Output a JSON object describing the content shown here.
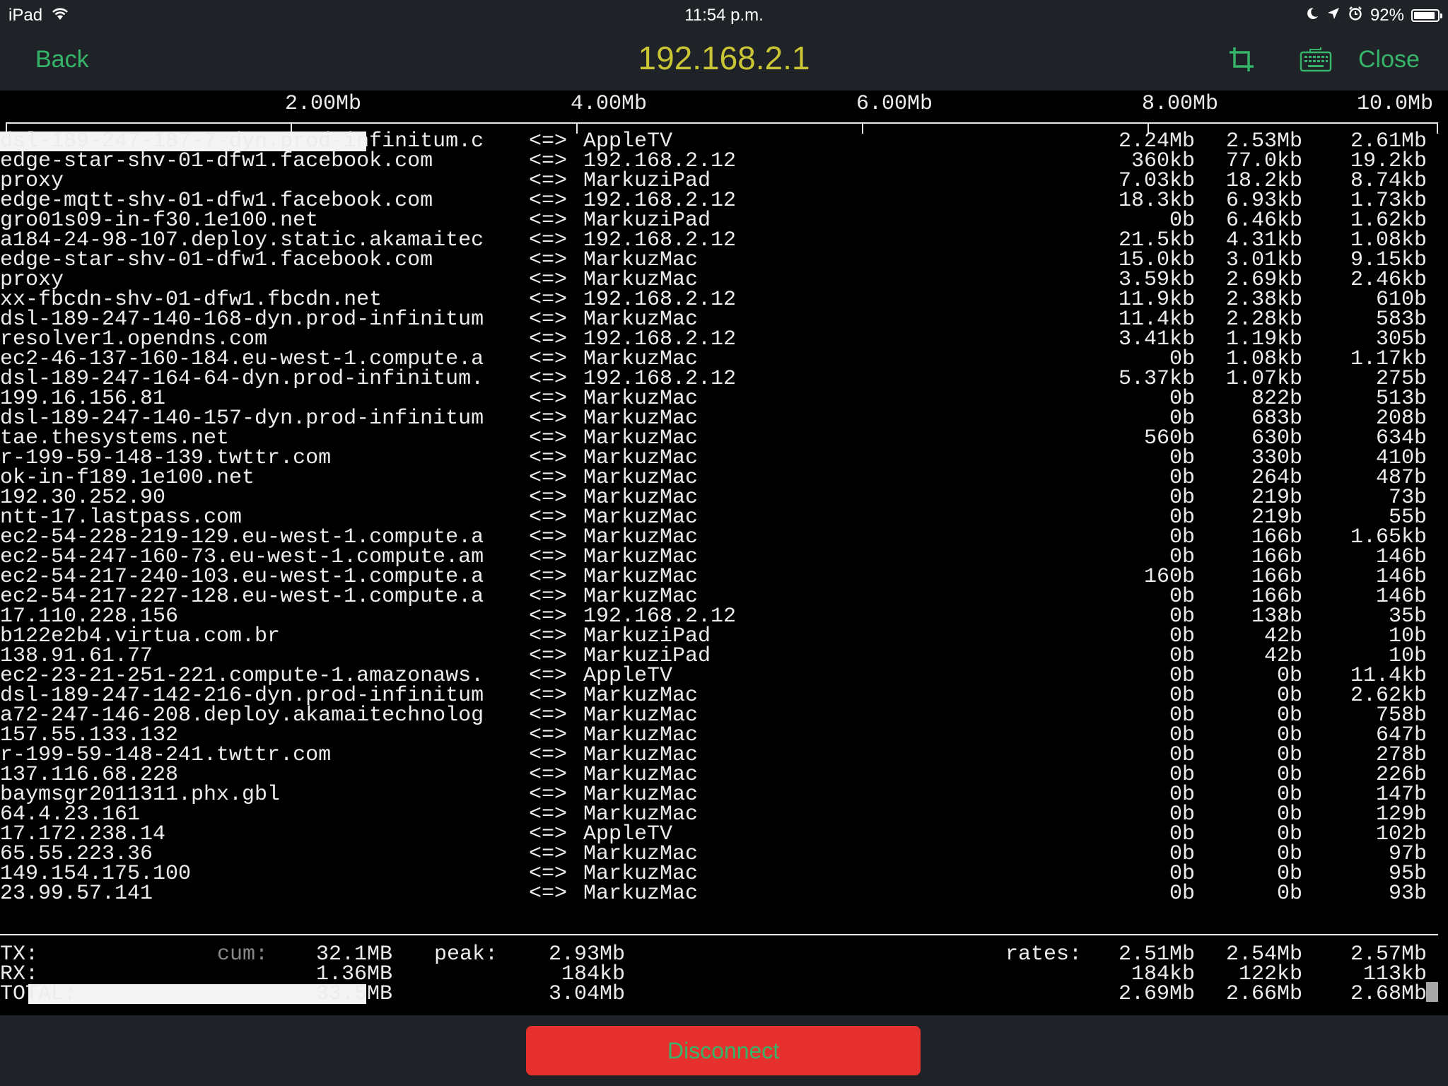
{
  "status_bar": {
    "device": "iPad",
    "time": "11:54 p.m.",
    "battery_percent": "92%",
    "battery_level": 0.92,
    "icons": [
      "wifi-icon",
      "moon-icon",
      "location-arrow-icon",
      "alarm-icon",
      "battery-icon"
    ]
  },
  "nav": {
    "back_label": "Back",
    "title": "192.168.2.1",
    "crop_icon": "crop-icon",
    "keyboard_icon": "keyboard-icon",
    "close_label": "Close"
  },
  "colors": {
    "bar_background": "#1f2327",
    "accent_green": "#36b56a",
    "title_yellow": "#c9c534",
    "disconnect_red": "#e5302e",
    "terminal_text": "#ececec"
  },
  "scale": {
    "labels": [
      "2.00Mb",
      "4.00Mb",
      "6.00Mb",
      "8.00Mb",
      "10.0Mb"
    ]
  },
  "connections": [
    {
      "host": "dsl-189-247-187-7-dyn.prod-infinitum.c",
      "dir": "<=>",
      "peer": "AppleTV",
      "r1": "2.24Mb",
      "r2": "2.53Mb",
      "r3": "2.61Mb"
    },
    {
      "host": "edge-star-shv-01-dfw1.facebook.com",
      "dir": "<=>",
      "peer": "192.168.2.12",
      "r1": "360kb",
      "r2": "77.0kb",
      "r3": "19.2kb"
    },
    {
      "host": "proxy",
      "dir": "<=>",
      "peer": "MarkuziPad",
      "r1": "7.03kb",
      "r2": "18.2kb",
      "r3": "8.74kb"
    },
    {
      "host": "edge-mqtt-shv-01-dfw1.facebook.com",
      "dir": "<=>",
      "peer": "192.168.2.12",
      "r1": "18.3kb",
      "r2": "6.93kb",
      "r3": "1.73kb"
    },
    {
      "host": "gro01s09-in-f30.1e100.net",
      "dir": "<=>",
      "peer": "MarkuziPad",
      "r1": "0b",
      "r2": "6.46kb",
      "r3": "1.62kb"
    },
    {
      "host": "a184-24-98-107.deploy.static.akamaitec",
      "dir": "<=>",
      "peer": "192.168.2.12",
      "r1": "21.5kb",
      "r2": "4.31kb",
      "r3": "1.08kb"
    },
    {
      "host": "edge-star-shv-01-dfw1.facebook.com",
      "dir": "<=>",
      "peer": "MarkuzMac",
      "r1": "15.0kb",
      "r2": "3.01kb",
      "r3": "9.15kb"
    },
    {
      "host": "proxy",
      "dir": "<=>",
      "peer": "MarkuzMac",
      "r1": "3.59kb",
      "r2": "2.69kb",
      "r3": "2.46kb"
    },
    {
      "host": "xx-fbcdn-shv-01-dfw1.fbcdn.net",
      "dir": "<=>",
      "peer": "192.168.2.12",
      "r1": "11.9kb",
      "r2": "2.38kb",
      "r3": "610b"
    },
    {
      "host": "dsl-189-247-140-168-dyn.prod-infinitum",
      "dir": "<=>",
      "peer": "MarkuzMac",
      "r1": "11.4kb",
      "r2": "2.28kb",
      "r3": "583b"
    },
    {
      "host": "resolver1.opendns.com",
      "dir": "<=>",
      "peer": "192.168.2.12",
      "r1": "3.41kb",
      "r2": "1.19kb",
      "r3": "305b"
    },
    {
      "host": "ec2-46-137-160-184.eu-west-1.compute.a",
      "dir": "<=>",
      "peer": "MarkuzMac",
      "r1": "0b",
      "r2": "1.08kb",
      "r3": "1.17kb"
    },
    {
      "host": "dsl-189-247-164-64-dyn.prod-infinitum.",
      "dir": "<=>",
      "peer": "192.168.2.12",
      "r1": "5.37kb",
      "r2": "1.07kb",
      "r3": "275b"
    },
    {
      "host": "199.16.156.81",
      "dir": "<=>",
      "peer": "MarkuzMac",
      "r1": "0b",
      "r2": "822b",
      "r3": "513b"
    },
    {
      "host": "dsl-189-247-140-157-dyn.prod-infinitum",
      "dir": "<=>",
      "peer": "MarkuzMac",
      "r1": "0b",
      "r2": "683b",
      "r3": "208b"
    },
    {
      "host": "tae.thesystems.net",
      "dir": "<=>",
      "peer": "MarkuzMac",
      "r1": "560b",
      "r2": "630b",
      "r3": "634b"
    },
    {
      "host": "r-199-59-148-139.twttr.com",
      "dir": "<=>",
      "peer": "MarkuzMac",
      "r1": "0b",
      "r2": "330b",
      "r3": "410b"
    },
    {
      "host": "ok-in-f189.1e100.net",
      "dir": "<=>",
      "peer": "MarkuzMac",
      "r1": "0b",
      "r2": "264b",
      "r3": "487b"
    },
    {
      "host": "192.30.252.90",
      "dir": "<=>",
      "peer": "MarkuzMac",
      "r1": "0b",
      "r2": "219b",
      "r3": "73b"
    },
    {
      "host": "ntt-17.lastpass.com",
      "dir": "<=>",
      "peer": "MarkuzMac",
      "r1": "0b",
      "r2": "219b",
      "r3": "55b"
    },
    {
      "host": "ec2-54-228-219-129.eu-west-1.compute.a",
      "dir": "<=>",
      "peer": "MarkuzMac",
      "r1": "0b",
      "r2": "166b",
      "r3": "1.65kb"
    },
    {
      "host": "ec2-54-247-160-73.eu-west-1.compute.am",
      "dir": "<=>",
      "peer": "MarkuzMac",
      "r1": "0b",
      "r2": "166b",
      "r3": "146b"
    },
    {
      "host": "ec2-54-217-240-103.eu-west-1.compute.a",
      "dir": "<=>",
      "peer": "MarkuzMac",
      "r1": "160b",
      "r2": "166b",
      "r3": "146b"
    },
    {
      "host": "ec2-54-217-227-128.eu-west-1.compute.a",
      "dir": "<=>",
      "peer": "MarkuzMac",
      "r1": "0b",
      "r2": "166b",
      "r3": "146b"
    },
    {
      "host": "17.110.228.156",
      "dir": "<=>",
      "peer": "192.168.2.12",
      "r1": "0b",
      "r2": "138b",
      "r3": "35b"
    },
    {
      "host": "b122e2b4.virtua.com.br",
      "dir": "<=>",
      "peer": "MarkuziPad",
      "r1": "0b",
      "r2": "42b",
      "r3": "10b"
    },
    {
      "host": "138.91.61.77",
      "dir": "<=>",
      "peer": "MarkuziPad",
      "r1": "0b",
      "r2": "42b",
      "r3": "10b"
    },
    {
      "host": "ec2-23-21-251-221.compute-1.amazonaws.",
      "dir": "<=>",
      "peer": "AppleTV",
      "r1": "0b",
      "r2": "0b",
      "r3": "11.4kb"
    },
    {
      "host": "dsl-189-247-142-216-dyn.prod-infinitum",
      "dir": "<=>",
      "peer": "MarkuzMac",
      "r1": "0b",
      "r2": "0b",
      "r3": "2.62kb"
    },
    {
      "host": "a72-247-146-208.deploy.akamaitechnolog",
      "dir": "<=>",
      "peer": "MarkuzMac",
      "r1": "0b",
      "r2": "0b",
      "r3": "758b"
    },
    {
      "host": "157.55.133.132",
      "dir": "<=>",
      "peer": "MarkuzMac",
      "r1": "0b",
      "r2": "0b",
      "r3": "647b"
    },
    {
      "host": "r-199-59-148-241.twttr.com",
      "dir": "<=>",
      "peer": "MarkuzMac",
      "r1": "0b",
      "r2": "0b",
      "r3": "278b"
    },
    {
      "host": "137.116.68.228",
      "dir": "<=>",
      "peer": "MarkuzMac",
      "r1": "0b",
      "r2": "0b",
      "r3": "226b"
    },
    {
      "host": "baymsgr2011311.phx.gbl",
      "dir": "<=>",
      "peer": "MarkuzMac",
      "r1": "0b",
      "r2": "0b",
      "r3": "147b"
    },
    {
      "host": "64.4.23.161",
      "dir": "<=>",
      "peer": "MarkuzMac",
      "r1": "0b",
      "r2": "0b",
      "r3": "129b"
    },
    {
      "host": "17.172.238.14",
      "dir": "<=>",
      "peer": "AppleTV",
      "r1": "0b",
      "r2": "0b",
      "r3": "102b"
    },
    {
      "host": "65.55.223.36",
      "dir": "<=>",
      "peer": "MarkuzMac",
      "r1": "0b",
      "r2": "0b",
      "r3": "97b"
    },
    {
      "host": "149.154.175.100",
      "dir": "<=>",
      "peer": "MarkuzMac",
      "r1": "0b",
      "r2": "0b",
      "r3": "95b"
    },
    {
      "host": "23.99.57.141",
      "dir": "<=>",
      "peer": "MarkuzMac",
      "r1": "0b",
      "r2": "0b",
      "r3": "93b"
    }
  ],
  "totals": {
    "cum_label": "cum:",
    "peak_label": "peak:",
    "rates_label": "rates:",
    "rows": [
      {
        "name": "TX:",
        "cum": "32.1MB",
        "peak": "2.93Mb",
        "r1": "2.51Mb",
        "r2": "2.54Mb",
        "r3": "2.57Mb"
      },
      {
        "name": "RX:",
        "cum": "1.36MB",
        "peak": "184kb",
        "r1": "184kb",
        "r2": "122kb",
        "r3": "113kb"
      },
      {
        "name": "TOTAL:",
        "cum": "33.5MB",
        "peak": "3.04Mb",
        "r1": "2.69Mb",
        "r2": "2.66Mb",
        "r3": "2.68Mb"
      }
    ]
  },
  "bottom": {
    "disconnect_label": "Disconnect"
  }
}
